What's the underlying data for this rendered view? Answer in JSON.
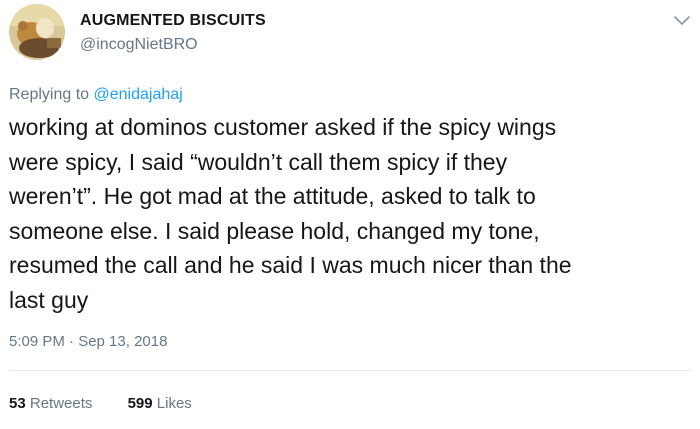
{
  "author": {
    "display_name": "AUGMENTED BISCUITS",
    "handle": "@incogNietBRO",
    "avatar_icon": "profile-avatar"
  },
  "reply": {
    "prefix": "Replying to ",
    "mention": "@enidajahaj"
  },
  "tweet": {
    "text": "working at dominos customer asked if the spicy wings\nwere spicy, I said “wouldn’t call them spicy if they\nweren’t”. He got mad at the attitude, asked to talk to\nsomeone else. I said please hold, changed my tone,\nresumed the call and he said I was much nicer than the\nlast guy",
    "timestamp": "5:09 PM · Sep 13, 2018"
  },
  "stats": {
    "retweets_count": "53",
    "retweets_label": "Retweets",
    "likes_count": "599",
    "likes_label": "Likes"
  },
  "menu": {
    "icon": "chevron-down-icon"
  },
  "colors": {
    "text": "#14171a",
    "secondary": "#657786",
    "link": "#1da1f2",
    "divider": "#e6ecf0"
  }
}
